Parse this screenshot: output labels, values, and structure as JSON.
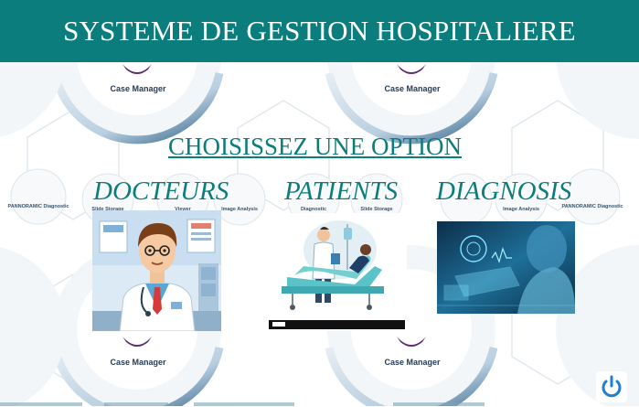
{
  "header": {
    "title": "SYSTEME DE GESTION HOSPITALIERE"
  },
  "main": {
    "subtitle": "CHOISISSEZ UNE OPTION",
    "options": [
      {
        "label": "DOCTEURS",
        "icon": "doctor-illustration"
      },
      {
        "label": "PATIENTS",
        "icon": "patient-bed-illustration"
      },
      {
        "label": "DIAGNOSIS",
        "icon": "diagnosis-hologram-photo"
      }
    ]
  },
  "background": {
    "watermark_text": "Case Manager",
    "module_labels": [
      "PANNORAMIC Diagnostic",
      "Slide Storage",
      "Viewer",
      "Image Analysis",
      "Diagnostic"
    ]
  },
  "power_button": {
    "icon": "power-icon"
  },
  "colors": {
    "accent": "#0b7d7d",
    "header_bg": "#0b7d7d",
    "text_light": "#ffffff"
  }
}
